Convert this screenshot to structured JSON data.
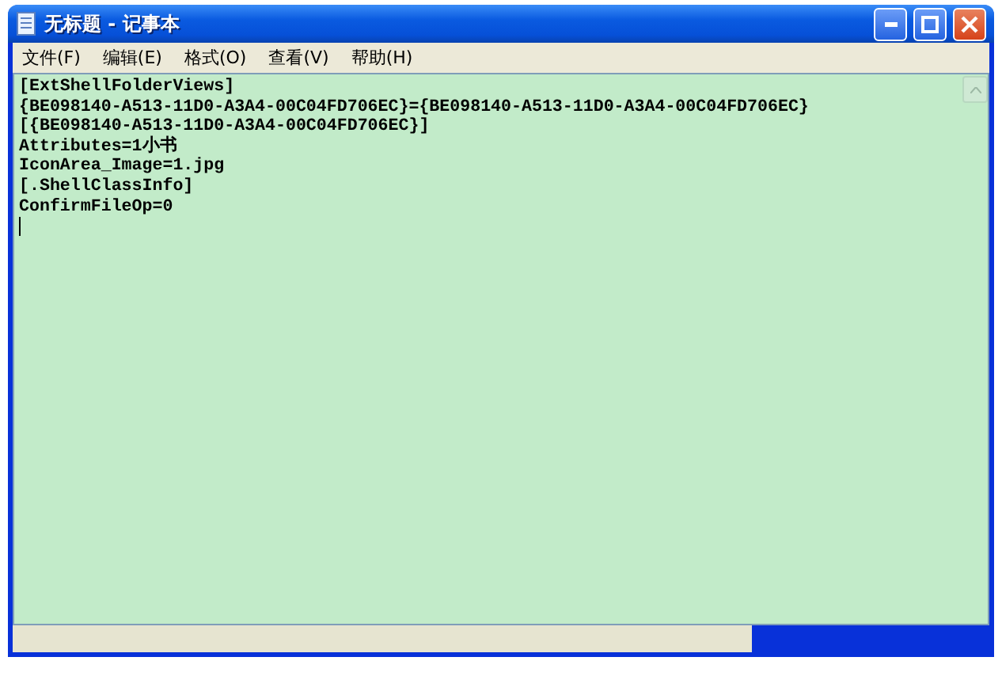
{
  "window": {
    "title": "无标题 - 记事本"
  },
  "menu": [
    {
      "label": "文件(F)"
    },
    {
      "label": "编辑(E)"
    },
    {
      "label": "格式(O)"
    },
    {
      "label": "查看(V)"
    },
    {
      "label": "帮助(H)"
    }
  ],
  "editor": {
    "lines": [
      "[ExtShellFolderViews]",
      "{BE098140-A513-11D0-A3A4-00C04FD706EC}={BE098140-A513-11D0-A3A4-00C04FD706EC}",
      "[{BE098140-A513-11D0-A3A4-00C04FD706EC}]",
      "Attributes=1小书",
      "IconArea_Image=1.jpg",
      "[.ShellClassInfo]",
      "ConfirmFileOp=0"
    ]
  }
}
